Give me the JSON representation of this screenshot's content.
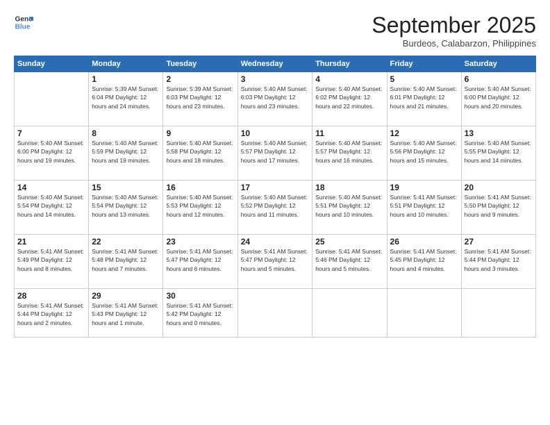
{
  "logo": {
    "line1": "General",
    "line2": "Blue"
  },
  "title": "September 2025",
  "subtitle": "Burdeos, Calabarzon, Philippines",
  "days_header": [
    "Sunday",
    "Monday",
    "Tuesday",
    "Wednesday",
    "Thursday",
    "Friday",
    "Saturday"
  ],
  "weeks": [
    [
      {
        "day": "",
        "info": ""
      },
      {
        "day": "1",
        "info": "Sunrise: 5:39 AM\nSunset: 6:04 PM\nDaylight: 12 hours\nand 24 minutes."
      },
      {
        "day": "2",
        "info": "Sunrise: 5:39 AM\nSunset: 6:03 PM\nDaylight: 12 hours\nand 23 minutes."
      },
      {
        "day": "3",
        "info": "Sunrise: 5:40 AM\nSunset: 6:03 PM\nDaylight: 12 hours\nand 23 minutes."
      },
      {
        "day": "4",
        "info": "Sunrise: 5:40 AM\nSunset: 6:02 PM\nDaylight: 12 hours\nand 22 minutes."
      },
      {
        "day": "5",
        "info": "Sunrise: 5:40 AM\nSunset: 6:01 PM\nDaylight: 12 hours\nand 21 minutes."
      },
      {
        "day": "6",
        "info": "Sunrise: 5:40 AM\nSunset: 6:00 PM\nDaylight: 12 hours\nand 20 minutes."
      }
    ],
    [
      {
        "day": "7",
        "info": "Sunrise: 5:40 AM\nSunset: 6:00 PM\nDaylight: 12 hours\nand 19 minutes."
      },
      {
        "day": "8",
        "info": "Sunrise: 5:40 AM\nSunset: 5:59 PM\nDaylight: 12 hours\nand 19 minutes."
      },
      {
        "day": "9",
        "info": "Sunrise: 5:40 AM\nSunset: 5:58 PM\nDaylight: 12 hours\nand 18 minutes."
      },
      {
        "day": "10",
        "info": "Sunrise: 5:40 AM\nSunset: 5:57 PM\nDaylight: 12 hours\nand 17 minutes."
      },
      {
        "day": "11",
        "info": "Sunrise: 5:40 AM\nSunset: 5:57 PM\nDaylight: 12 hours\nand 16 minutes."
      },
      {
        "day": "12",
        "info": "Sunrise: 5:40 AM\nSunset: 5:56 PM\nDaylight: 12 hours\nand 15 minutes."
      },
      {
        "day": "13",
        "info": "Sunrise: 5:40 AM\nSunset: 5:55 PM\nDaylight: 12 hours\nand 14 minutes."
      }
    ],
    [
      {
        "day": "14",
        "info": "Sunrise: 5:40 AM\nSunset: 5:54 PM\nDaylight: 12 hours\nand 14 minutes."
      },
      {
        "day": "15",
        "info": "Sunrise: 5:40 AM\nSunset: 5:54 PM\nDaylight: 12 hours\nand 13 minutes."
      },
      {
        "day": "16",
        "info": "Sunrise: 5:40 AM\nSunset: 5:53 PM\nDaylight: 12 hours\nand 12 minutes."
      },
      {
        "day": "17",
        "info": "Sunrise: 5:40 AM\nSunset: 5:52 PM\nDaylight: 12 hours\nand 11 minutes."
      },
      {
        "day": "18",
        "info": "Sunrise: 5:40 AM\nSunset: 5:51 PM\nDaylight: 12 hours\nand 10 minutes."
      },
      {
        "day": "19",
        "info": "Sunrise: 5:41 AM\nSunset: 5:51 PM\nDaylight: 12 hours\nand 10 minutes."
      },
      {
        "day": "20",
        "info": "Sunrise: 5:41 AM\nSunset: 5:50 PM\nDaylight: 12 hours\nand 9 minutes."
      }
    ],
    [
      {
        "day": "21",
        "info": "Sunrise: 5:41 AM\nSunset: 5:49 PM\nDaylight: 12 hours\nand 8 minutes."
      },
      {
        "day": "22",
        "info": "Sunrise: 5:41 AM\nSunset: 5:48 PM\nDaylight: 12 hours\nand 7 minutes."
      },
      {
        "day": "23",
        "info": "Sunrise: 5:41 AM\nSunset: 5:47 PM\nDaylight: 12 hours\nand 6 minutes."
      },
      {
        "day": "24",
        "info": "Sunrise: 5:41 AM\nSunset: 5:47 PM\nDaylight: 12 hours\nand 5 minutes."
      },
      {
        "day": "25",
        "info": "Sunrise: 5:41 AM\nSunset: 5:46 PM\nDaylight: 12 hours\nand 5 minutes."
      },
      {
        "day": "26",
        "info": "Sunrise: 5:41 AM\nSunset: 5:45 PM\nDaylight: 12 hours\nand 4 minutes."
      },
      {
        "day": "27",
        "info": "Sunrise: 5:41 AM\nSunset: 5:44 PM\nDaylight: 12 hours\nand 3 minutes."
      }
    ],
    [
      {
        "day": "28",
        "info": "Sunrise: 5:41 AM\nSunset: 5:44 PM\nDaylight: 12 hours\nand 2 minutes."
      },
      {
        "day": "29",
        "info": "Sunrise: 5:41 AM\nSunset: 5:43 PM\nDaylight: 12 hours\nand 1 minute."
      },
      {
        "day": "30",
        "info": "Sunrise: 5:41 AM\nSunset: 5:42 PM\nDaylight: 12 hours\nand 0 minutes."
      },
      {
        "day": "",
        "info": ""
      },
      {
        "day": "",
        "info": ""
      },
      {
        "day": "",
        "info": ""
      },
      {
        "day": "",
        "info": ""
      }
    ]
  ]
}
